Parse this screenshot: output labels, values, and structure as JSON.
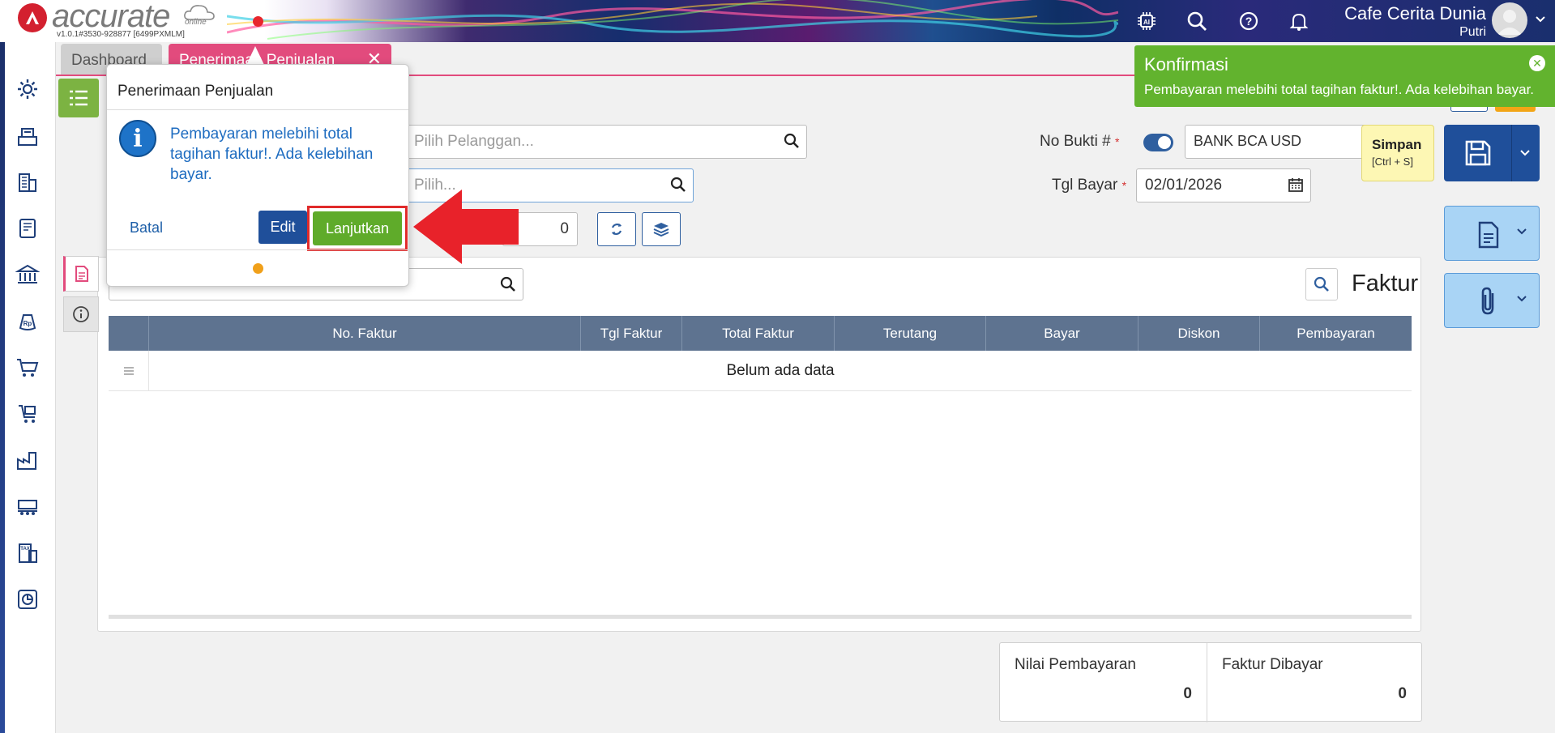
{
  "header": {
    "logo_text": "accurate",
    "logo_sub": "online",
    "version": "v1.0.1#3530-928877 [6499PXMLM]",
    "company": "Cafe Cerita Dunia",
    "user": "Putri",
    "icons": [
      "ai-chip-icon",
      "search-icon",
      "help-icon",
      "bell-icon"
    ]
  },
  "tabs": [
    {
      "label": "Dashboard"
    },
    {
      "label": "Penerimaan Penjualan",
      "close": "✕"
    }
  ],
  "form": {
    "pelanggan_placeholder": "Pilih Pelanggan...",
    "pilih_placeholder": "Pilih...",
    "amount_value": "0",
    "no_bukti_label": "No Bukti #",
    "bank_value": "BANK BCA USD",
    "tgl_bayar_label": "Tgl Bayar",
    "tgl_bayar_value": "02/01/2026",
    "required_mark": "*"
  },
  "tooltip": {
    "title": "Simpan",
    "shortcut": "[Ctrl + S]"
  },
  "notification": {
    "title": "Konfirmasi",
    "message": "Pembayaran melebihi total tagihan faktur!. Ada kelebihan bayar."
  },
  "table": {
    "title": "Faktur",
    "columns": [
      "No. Faktur",
      "Tgl Faktur",
      "Total Faktur",
      "Terutang",
      "Bayar",
      "Diskon",
      "Pembayaran"
    ],
    "empty_text": "Belum ada data"
  },
  "summary": {
    "nilai_label": "Nilai Pembayaran",
    "nilai_value": "0",
    "faktur_label": "Faktur Dibayar",
    "faktur_value": "0"
  },
  "dialog": {
    "title": "Penerimaan Penjualan",
    "message": "Pembayaran melebihi total tagihan faktur!. Ada kelebihan bayar.",
    "cancel_label": "Batal",
    "edit_label": "Edit",
    "continue_label": "Lanjutkan"
  },
  "colors": {
    "accent_pink": "#e24b7d",
    "primary_blue": "#1f4f9a",
    "success_green": "#62b32e",
    "highlight_red": "#e02a2a"
  }
}
